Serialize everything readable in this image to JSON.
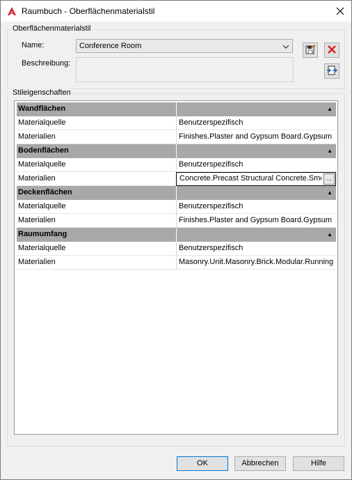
{
  "window": {
    "title": "Raumbuch - Oberflächenmaterialstil",
    "app_icon": "autocad-icon",
    "close_icon": "close-icon"
  },
  "surface_style": {
    "group_label": "Oberflächenmaterialstil",
    "name_label": "Name:",
    "name_value": "Conference Room",
    "description_label": "Beschreibung:",
    "description_value": "",
    "save_icon": "save-edit-icon",
    "delete_icon": "delete-icon",
    "import_icon": "import-export-icon"
  },
  "properties": {
    "group_label": "Stileigenschaften",
    "sections": [
      {
        "title": "Wandflächen",
        "rows": [
          {
            "label": "Materialquelle",
            "value": "Benutzerspezifisch"
          },
          {
            "label": "Materialien",
            "value": "Finishes.Plaster and Gypsum Board.Gypsum"
          }
        ]
      },
      {
        "title": "Bodenflächen",
        "rows": [
          {
            "label": "Materialquelle",
            "value": "Benutzerspezifisch"
          },
          {
            "label": "Materialien",
            "value": "Concrete.Precast Structural Concrete.Smooth"
          }
        ]
      },
      {
        "title": "Deckenflächen",
        "rows": [
          {
            "label": "Materialquelle",
            "value": "Benutzerspezifisch"
          },
          {
            "label": "Materialien",
            "value": "Finishes.Plaster and Gypsum Board.Gypsum"
          }
        ]
      },
      {
        "title": "Raumumfang",
        "rows": [
          {
            "label": "Materialquelle",
            "value": "Benutzerspezifisch"
          },
          {
            "label": "Materialien",
            "value": "Masonry.Unit.Masonry.Brick.Modular.Running"
          }
        ]
      }
    ],
    "ellipsis_label": "..."
  },
  "buttons": {
    "ok": "OK",
    "cancel": "Abbrechen",
    "help": "Hilfe"
  }
}
